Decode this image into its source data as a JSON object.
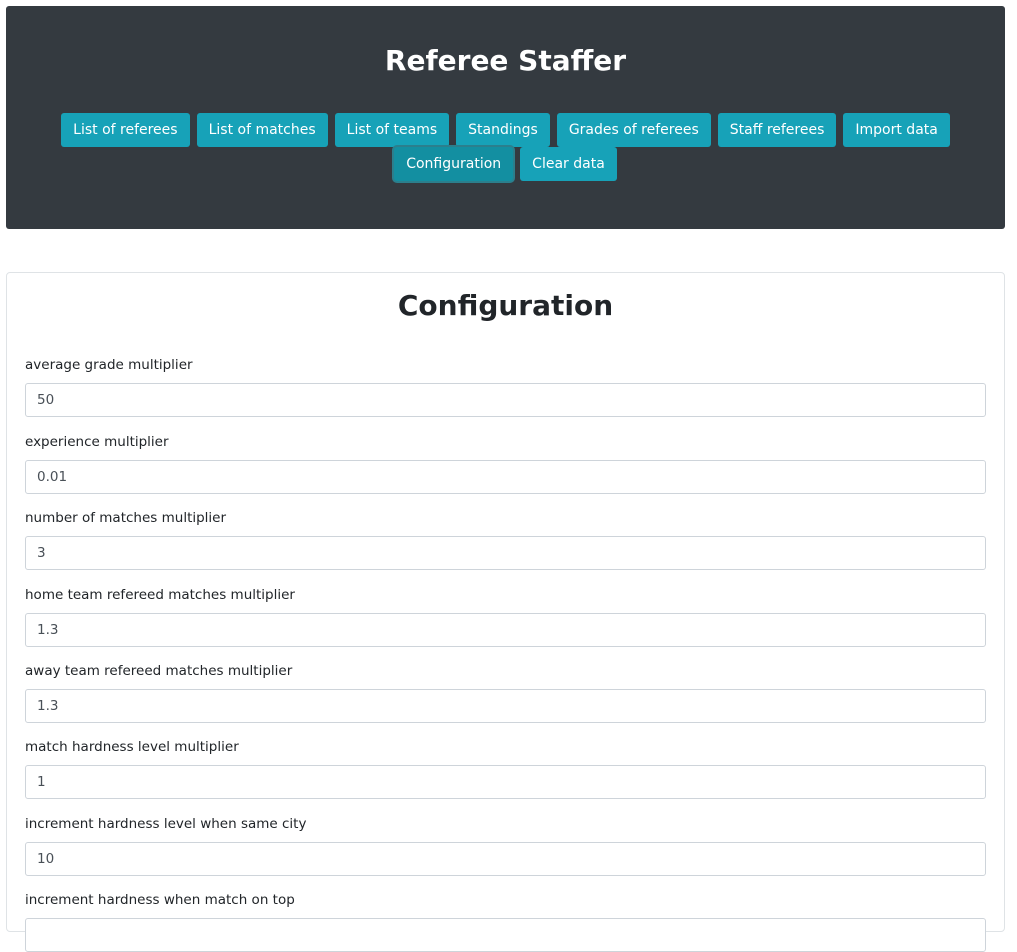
{
  "header": {
    "title": "Referee Staffer",
    "nav": [
      {
        "label": "List of referees",
        "active": false
      },
      {
        "label": "List of matches",
        "active": false
      },
      {
        "label": "List of teams",
        "active": false
      },
      {
        "label": "Standings",
        "active": false
      },
      {
        "label": "Grades of referees",
        "active": false
      },
      {
        "label": "Staff referees",
        "active": false
      },
      {
        "label": "Import data",
        "active": false
      },
      {
        "label": "Configuration",
        "active": true
      },
      {
        "label": "Clear data",
        "active": false
      }
    ]
  },
  "colors": {
    "header_bg": "#343a40",
    "button_bg": "#17a2b8",
    "button_text": "#ffffff"
  },
  "config": {
    "title": "Configuration",
    "fields": [
      {
        "label": "average grade multiplier",
        "value": "50"
      },
      {
        "label": "experience multiplier",
        "value": "0.01"
      },
      {
        "label": "number of matches multiplier",
        "value": "3"
      },
      {
        "label": "home team refereed matches multiplier",
        "value": "1.3"
      },
      {
        "label": "away team refereed matches multiplier",
        "value": "1.3"
      },
      {
        "label": "match hardness level multiplier",
        "value": "1"
      },
      {
        "label": "increment hardness level when same city",
        "value": "10"
      },
      {
        "label": "increment hardness when match on top",
        "value": ""
      }
    ]
  }
}
